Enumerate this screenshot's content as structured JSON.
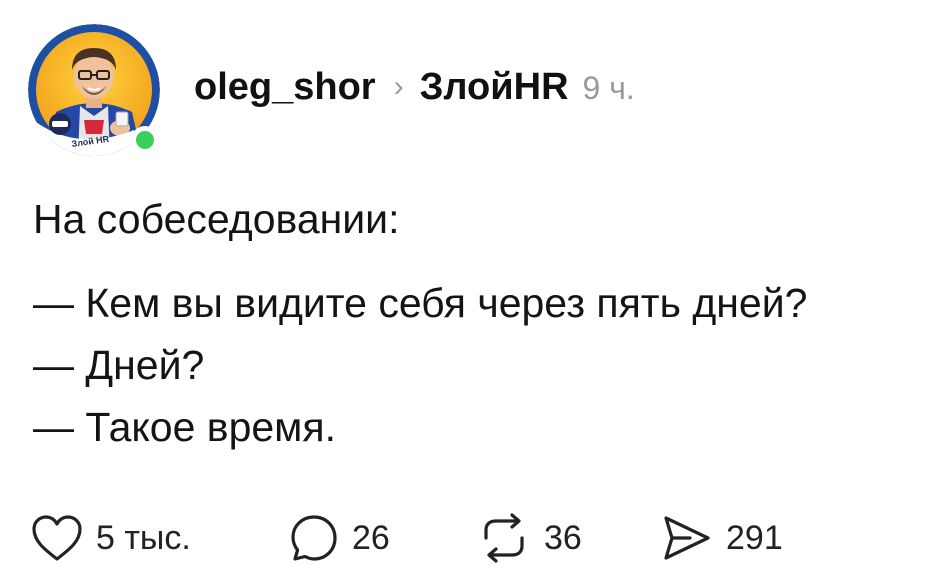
{
  "post": {
    "author": "oleg_shor",
    "separator": "›",
    "community": "ЗлойHR",
    "time": "9 ч.",
    "avatar_badge_text": "Злой HR",
    "lines": [
      "На собеседовании:",
      "— Кем вы видите себя через пять дней?",
      "— Дней?",
      "— Такое время."
    ]
  },
  "actions": {
    "likes": "5 тыс.",
    "comments": "26",
    "reposts": "36",
    "shares": "291"
  },
  "colors": {
    "online": "#3ad05a",
    "muted": "#9a9a9a",
    "text": "#111111"
  },
  "icons": {
    "like": "heart-icon",
    "comment": "comment-bubble-icon",
    "repost": "repost-icon",
    "share": "send-icon"
  }
}
